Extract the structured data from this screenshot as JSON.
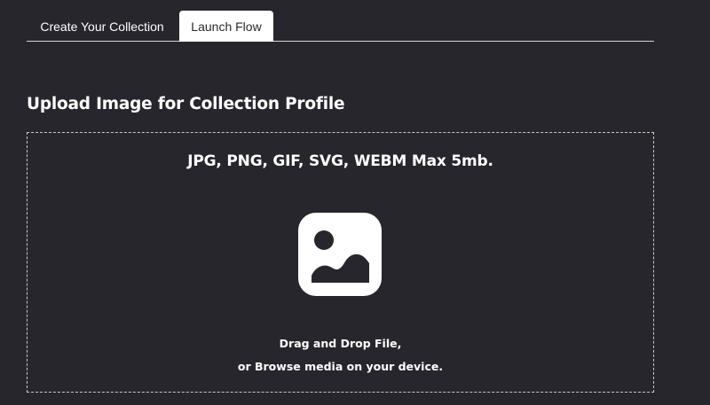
{
  "tabs": [
    {
      "label": "Create Your Collection",
      "active": false
    },
    {
      "label": "Launch Flow",
      "active": true
    }
  ],
  "upload": {
    "title": "Upload Image for Collection Profile",
    "formats": "JPG, PNG, GIF, SVG, WEBM Max 5mb.",
    "icon": "image-icon",
    "drag_text": "Drag and Drop File,",
    "browse_text": "or Browse media on your device."
  },
  "colors": {
    "background": "#27262c",
    "active_tab": "#ffffff",
    "text": "#ffffff"
  }
}
